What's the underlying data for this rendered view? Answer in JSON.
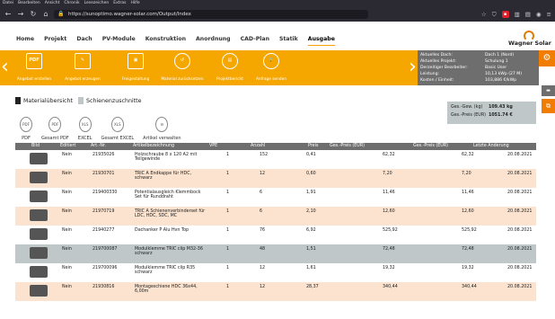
{
  "browser": {
    "menu": [
      "Datei",
      "Bearbeiten",
      "Ansicht",
      "Chronik",
      "Lesezeichen",
      "Extras",
      "Hilfe"
    ],
    "url": "https://sunoptimo.wagner-solar.com/Output/Index"
  },
  "nav": {
    "tabs": [
      "Home",
      "Projekt",
      "Dach",
      "PV-Module",
      "Konstruktion",
      "Anordnung",
      "CAD-Plan",
      "Statik",
      "Ausgabe"
    ],
    "logo": "Wagner Solar"
  },
  "toolbar": {
    "tools": [
      {
        "icon": "pdf-icon",
        "label": "Angebot erstellen"
      },
      {
        "icon": "edit-icon",
        "label": "Angebot erzeugen"
      },
      {
        "icon": "release-icon",
        "label": "Freigestaltung"
      },
      {
        "icon": "undo-icon",
        "label": "Material zurücksetzen"
      },
      {
        "icon": "report-icon",
        "label": "Projektbericht"
      },
      {
        "icon": "lock-icon",
        "label": "Anfrage senden"
      }
    ]
  },
  "info": {
    "rows": [
      {
        "label": "Aktuelles Dach:",
        "value": "Dach 1 (Nord)"
      },
      {
        "label": "Aktuelles Projekt:",
        "value": "Schulung 1"
      },
      {
        "label": "Derzeitiger Bearbeiter:",
        "value": "Basic User"
      },
      {
        "label": "Leistung:",
        "value": "10,13 kWp (27 M)"
      },
      {
        "label": "Kosten / Einheit:",
        "value": "103,886 €/kWp"
      }
    ]
  },
  "panel_tabs": [
    "Materialübersicht",
    "Schienenzuschnitte"
  ],
  "summary": {
    "weight_label": "Ges.-Gew. (kg)",
    "weight": "109.43 kg",
    "price_label": "Ges.-Preis (EUR)",
    "price": "1051.74 €"
  },
  "exports": [
    {
      "icon": "PDF",
      "label": "PDF"
    },
    {
      "icon": "PDF",
      "label": "Gesamt PDF"
    },
    {
      "icon": "XLS",
      "label": "EXCEL"
    },
    {
      "icon": "XLS",
      "label": "Gesamt EXCEL"
    },
    {
      "icon": "⚙",
      "label": "Artikel verwalten"
    }
  ],
  "table": {
    "headers": [
      "Bild",
      "Editiert",
      "Art.-Nr.",
      "Artikelbezeichnung",
      "VPE",
      "Anzahl",
      "Preis",
      "Ges.-Preis (EUR)",
      "Ges.-Preis (EUR)",
      "Letzte Änderung"
    ],
    "rows": [
      {
        "edited": "Nein",
        "art": "21935026",
        "name": "Holzschraube 8 x 120 A2 mit Teilgewinde",
        "vpe": "1",
        "qty": "152",
        "price": "0,41",
        "total": "62,32",
        "total2": "62,32",
        "date": "20.08.2021"
      },
      {
        "edited": "Nein",
        "art": "21930701",
        "name": "TRIC A Endkappe für HDC, schwarz",
        "vpe": "1",
        "qty": "12",
        "price": "0,60",
        "total": "7,20",
        "total2": "7,20",
        "date": "20.08.2021"
      },
      {
        "edited": "Nein",
        "art": "219400330",
        "name": "Potentialausgleich Klemmbock Set für Runddraht",
        "vpe": "1",
        "qty": "6",
        "price": "1,91",
        "total": "11,46",
        "total2": "11,46",
        "date": "20.08.2021"
      },
      {
        "edited": "Nein",
        "art": "21970719",
        "name": "TRIC A Schienenverbinderset für LDC, HDC, SDC, MC",
        "vpe": "1",
        "qty": "6",
        "price": "2,10",
        "total": "12,60",
        "total2": "12,60",
        "date": "20.08.2021"
      },
      {
        "edited": "Nein",
        "art": "21940277",
        "name": "Dachanker P Alu Hvn Top",
        "vpe": "1",
        "qty": "76",
        "price": "6,92",
        "total": "525,92",
        "total2": "525,92",
        "date": "20.08.2021"
      },
      {
        "edited": "Nein",
        "art": "219700087",
        "name": "Modulklemme TRIC clip M32-36 schwarz",
        "vpe": "1",
        "qty": "48",
        "price": "1,51",
        "total": "72,48",
        "total2": "72,48",
        "date": "20.08.2021"
      },
      {
        "edited": "Nein",
        "art": "219700096",
        "name": "Modulklemme TRIC clip R35 schwarz",
        "vpe": "1",
        "qty": "12",
        "price": "1,61",
        "total": "19,32",
        "total2": "19,32",
        "date": "20.08.2021"
      },
      {
        "edited": "Nein",
        "art": "21930816",
        "name": "Montageschiene HDC 36x44, 6,00m",
        "vpe": "1",
        "qty": "12",
        "price": "28,37",
        "total": "340,44",
        "total2": "340,44",
        "date": "20.08.2021"
      }
    ]
  },
  "colors": {
    "accent": "#f5a700",
    "info_bg": "#6e6e6e",
    "row_alt": "#fbe3cf",
    "row_grey": "#bfc7c8"
  }
}
